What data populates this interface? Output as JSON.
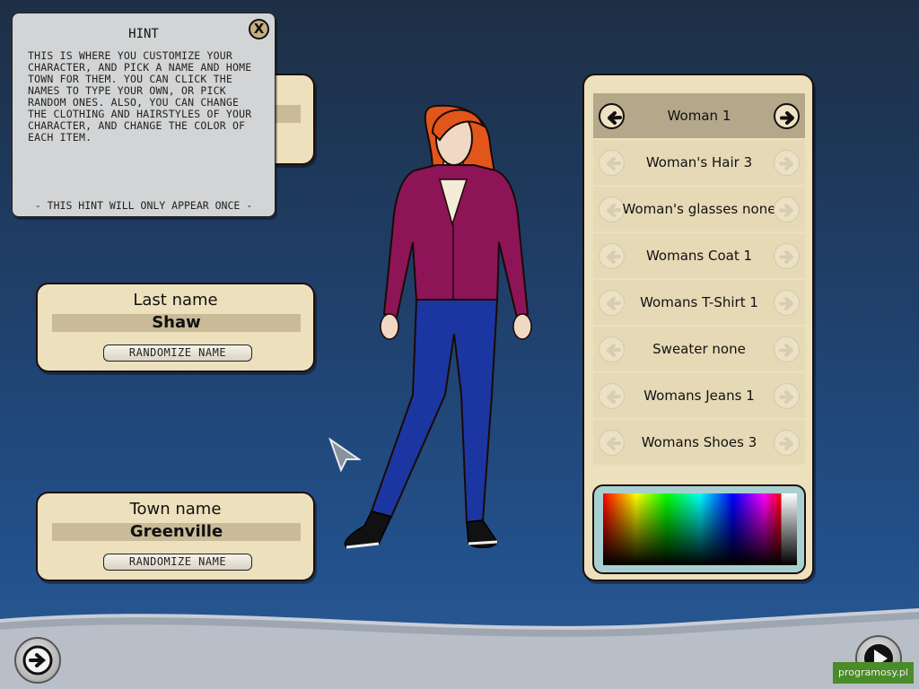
{
  "hint": {
    "title": "HINT",
    "close_label": "X",
    "body": "THIS IS WHERE YOU CUSTOMIZE YOUR CHARACTER, AND PICK A NAME AND HOME TOWN FOR THEM. YOU CAN CLICK THE NAMES TO TYPE YOUR OWN, OR PICK RANDOM ONES. ALSO, YOU CAN CHANGE THE CLOTHING AND HAIRSTYLES OF YOUR CHARACTER, AND CHANGE THE COLOR OF EACH ITEM.",
    "footer": "- THIS HINT WILL ONLY APPEAR ONCE -"
  },
  "last_name": {
    "title": "Last name",
    "value": "Shaw",
    "randomize_label": "RANDOMIZE NAME"
  },
  "town_name": {
    "title": "Town name",
    "value": "Greenville",
    "randomize_label": "RANDOMIZE NAME"
  },
  "items": [
    {
      "label": "Woman 1",
      "active": true
    },
    {
      "label": "Woman's Hair 3",
      "active": false
    },
    {
      "label": "Woman's glasses none",
      "active": false
    },
    {
      "label": "Womans Coat 1",
      "active": false
    },
    {
      "label": "Womans T-Shirt 1",
      "active": false
    },
    {
      "label": "Sweater none",
      "active": false
    },
    {
      "label": "Womans Jeans 1",
      "active": false
    },
    {
      "label": "Womans Shoes 3",
      "active": false
    }
  ],
  "watermark": "programosy.pl",
  "colors": {
    "panel": "#ede0bd",
    "hair": "#e2561b",
    "hoodie": "#8e1458",
    "jeans": "#1b36a0"
  }
}
